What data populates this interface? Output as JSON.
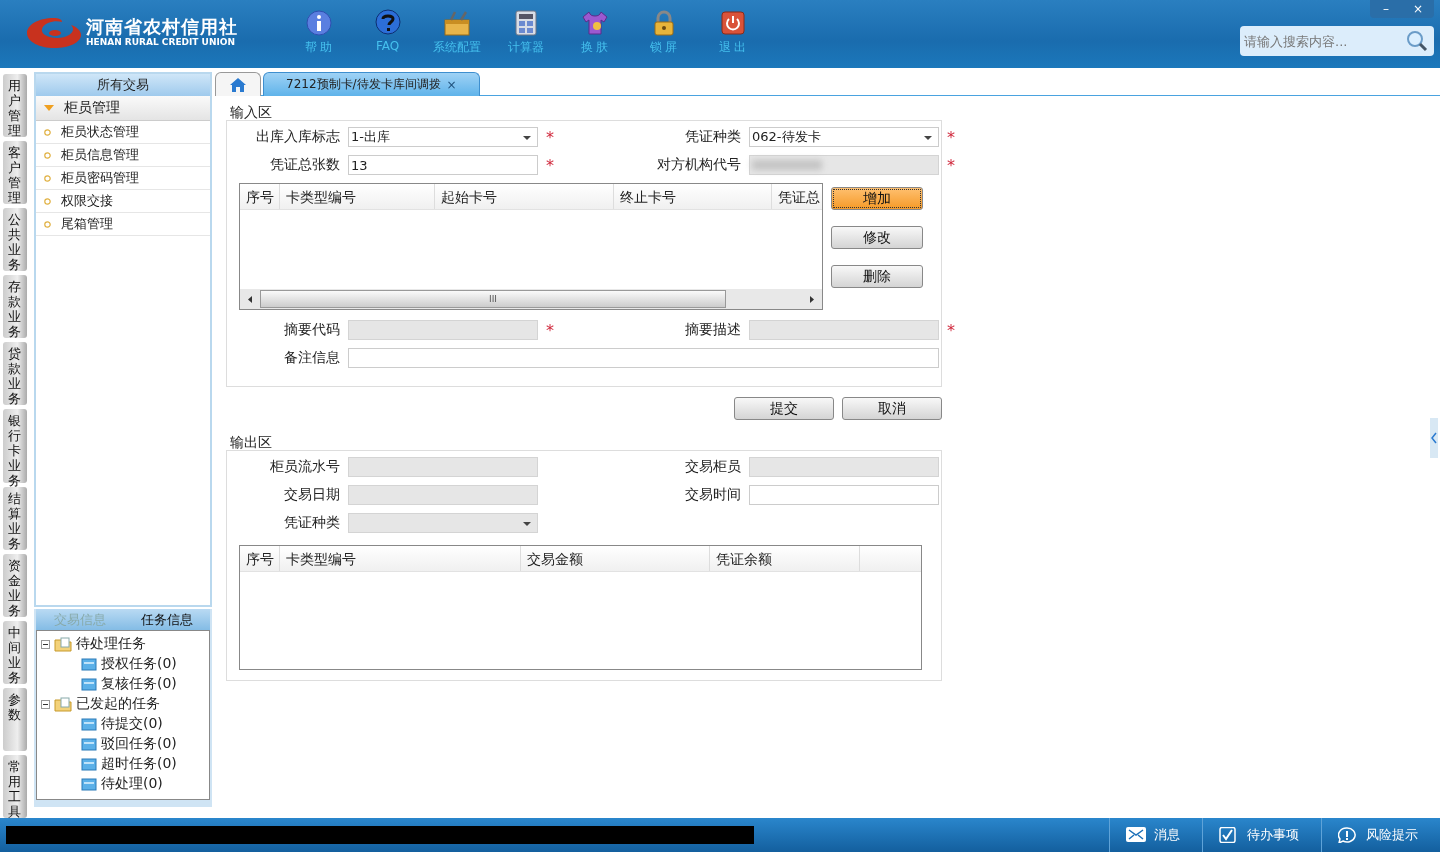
{
  "header": {
    "logo_title": "河南省农村信用社",
    "logo_subtitle": "HENAN RURAL CREDIT UNION",
    "toolbar": [
      {
        "kind": "info",
        "label": "帮 助"
      },
      {
        "kind": "question",
        "label": "FAQ"
      },
      {
        "kind": "toolbox",
        "label": "系统配置"
      },
      {
        "kind": "calculator",
        "label": "计算器"
      },
      {
        "kind": "shirt",
        "label": "换 肤"
      },
      {
        "kind": "lock",
        "label": "锁 屏"
      },
      {
        "kind": "power",
        "label": "退 出"
      }
    ],
    "window_controls": [
      "–",
      "×"
    ],
    "search": {
      "placeholder": "请输入搜索内容..."
    }
  },
  "side_tabs": [
    "用户管理",
    "客户管理",
    "公共业务",
    "存款业务",
    "贷款业务",
    "银行卡业务",
    "结算业务",
    "资金业务",
    "中间业务",
    "参数",
    "常用工具"
  ],
  "sidebar": {
    "title": "所有交易",
    "group": {
      "label": "柜员管理",
      "expanded": true,
      "items": [
        "柜员状态管理",
        "柜员信息管理",
        "柜员密码管理",
        "权限交接",
        "尾箱管理"
      ]
    }
  },
  "task_panel": {
    "tabs": [
      {
        "label": "交易信息",
        "selected": false
      },
      {
        "label": "任务信息",
        "selected": true
      }
    ],
    "tree": [
      {
        "label": "待处理任务",
        "expanded": true,
        "children": [
          {
            "label": "授权任务(0)"
          },
          {
            "label": "复核任务(0)"
          }
        ]
      },
      {
        "label": "已发起的任务",
        "expanded": true,
        "children": [
          {
            "label": "待提交(0)"
          },
          {
            "label": "驳回任务(0)"
          },
          {
            "label": "超时任务(0)"
          },
          {
            "label": "待处理(0)"
          }
        ]
      }
    ]
  },
  "tabs": [
    {
      "kind": "home",
      "selected": false
    },
    {
      "kind": "page",
      "label": "7212预制卡/待发卡库间调拨",
      "close": "×",
      "selected": true
    }
  ],
  "input_area": {
    "legend": "输入区",
    "fields_top": [
      {
        "label": "出库入库标志",
        "kind": "select",
        "value": "1-出库",
        "disabled": false,
        "mark": "*"
      },
      {
        "label": "凭证种类",
        "kind": "select",
        "value": "062-待发卡",
        "disabled": false,
        "mark": "*"
      },
      {
        "label": "凭证总张数",
        "kind": "text",
        "value": "13",
        "disabled": false,
        "mark": "*"
      },
      {
        "label": "对方机构代号",
        "kind": "redacted",
        "disabled": true,
        "mark": "*"
      }
    ],
    "table": {
      "columns": [
        "序号",
        "卡类型编号",
        "起始卡号",
        "终止卡号",
        "凭证总"
      ],
      "scrollbar_grip": "III"
    },
    "table_buttons": [
      {
        "label": "增加",
        "focused": true
      },
      {
        "label": "修改",
        "focused": false
      },
      {
        "label": "删除",
        "focused": false
      }
    ],
    "fields_bottom": [
      {
        "label": "摘要代码",
        "kind": "text",
        "disabled": true,
        "mark": "*"
      },
      {
        "label": "摘要描述",
        "kind": "text",
        "disabled": true,
        "mark": "*"
      },
      {
        "label": "备注信息",
        "kind": "wide",
        "disabled": false
      }
    ]
  },
  "actions": [
    "提交",
    "取消"
  ],
  "output_area": {
    "legend": "输出区",
    "fields": [
      {
        "label": "柜员流水号",
        "kind": "text",
        "disabled": true
      },
      {
        "label": "交易柜员",
        "kind": "text",
        "disabled": true
      },
      {
        "label": "交易日期",
        "kind": "text",
        "disabled": true
      },
      {
        "label": "交易时间",
        "kind": "text",
        "disabled": false
      },
      {
        "label": "凭证种类",
        "kind": "select",
        "disabled": true
      }
    ],
    "table": {
      "columns": [
        "序号",
        "卡类型编号",
        "交易金额",
        "凭证余额"
      ]
    }
  },
  "status_bar": {
    "items": [
      {
        "kind": "mail",
        "label": "消息"
      },
      {
        "kind": "check",
        "label": "待办事项"
      },
      {
        "kind": "alert",
        "label": "风险提示"
      }
    ]
  }
}
